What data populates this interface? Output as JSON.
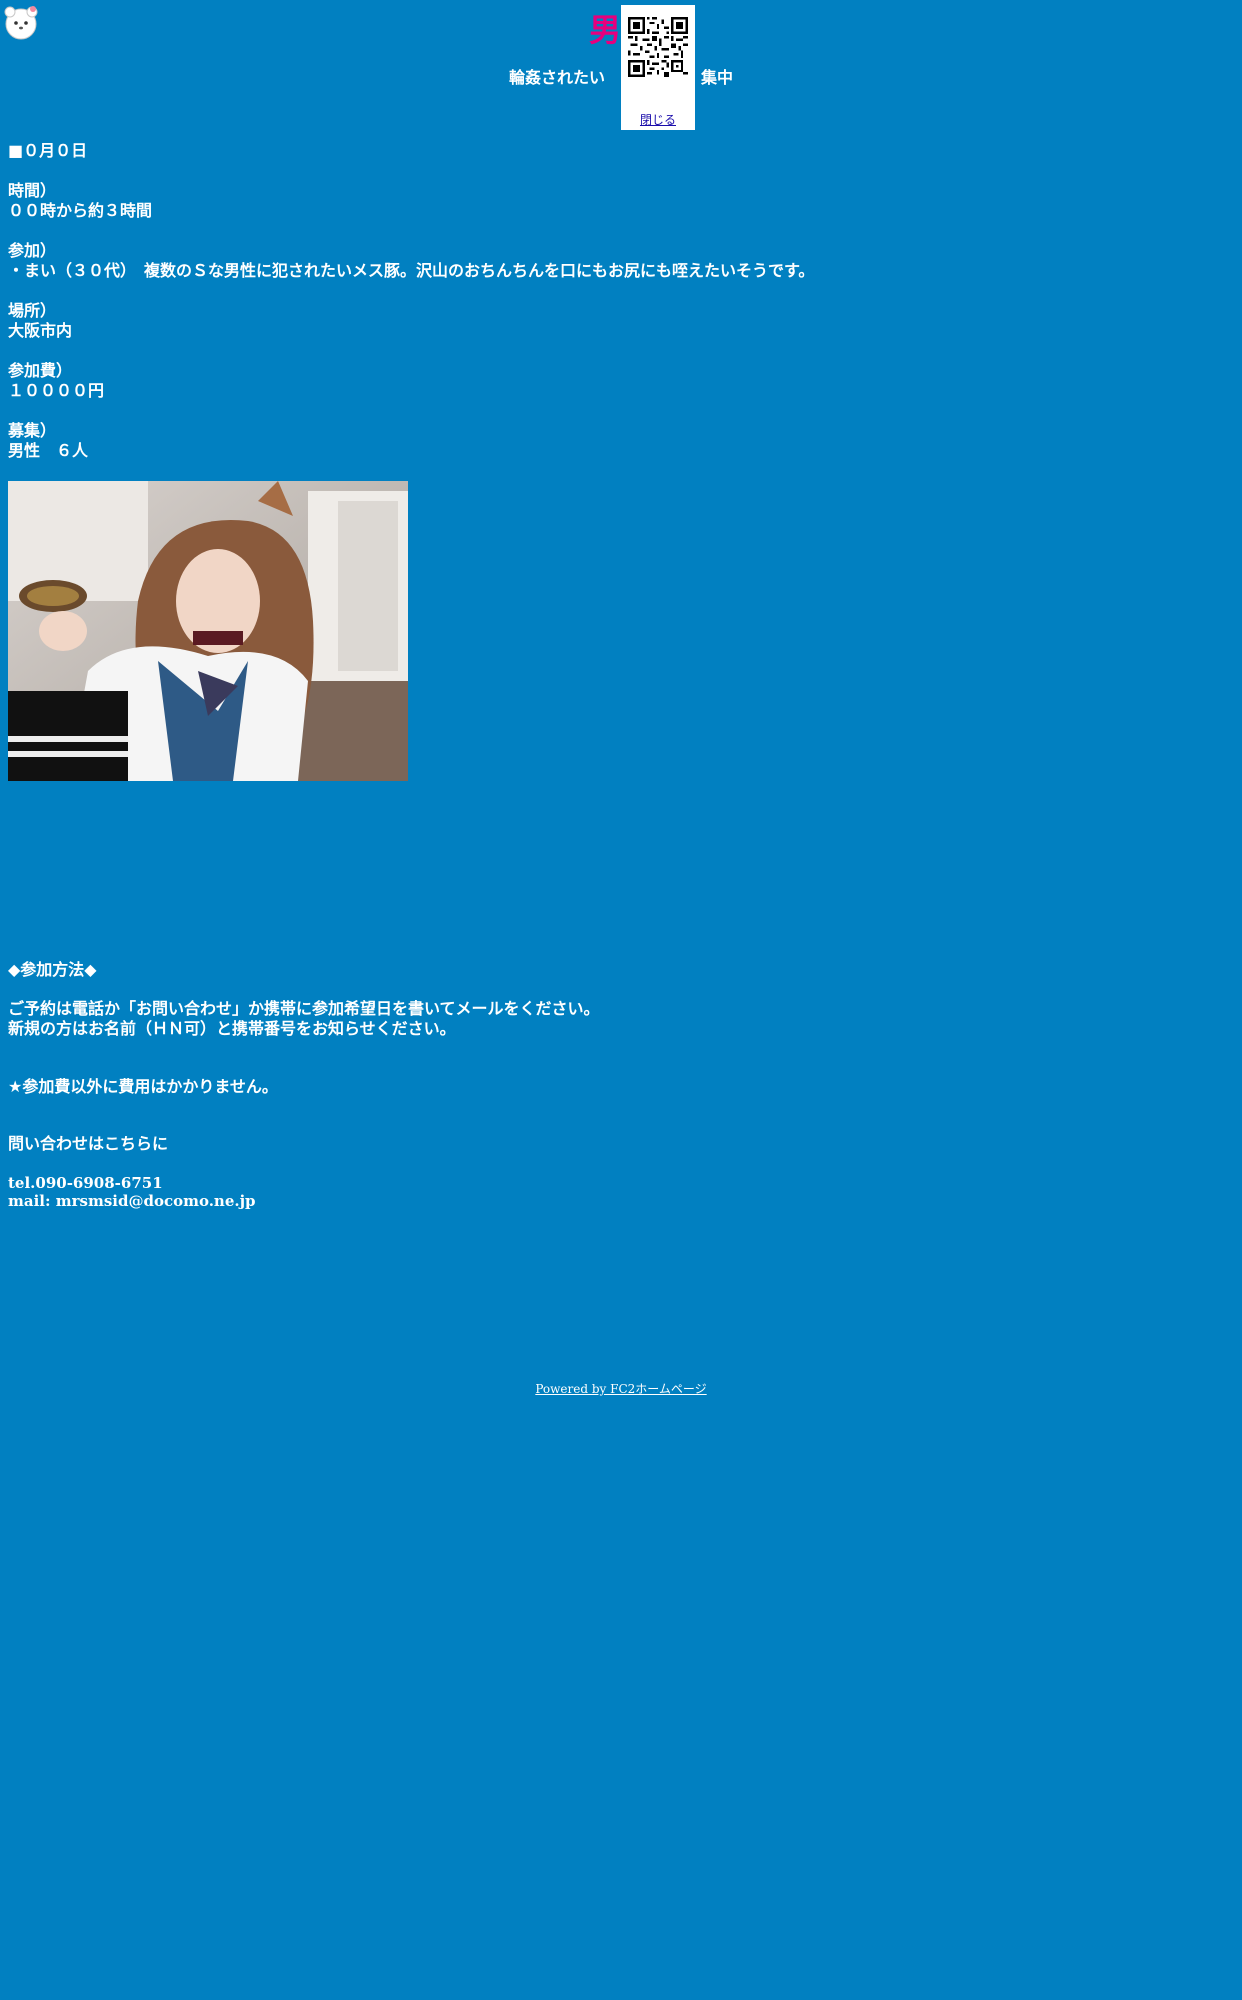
{
  "header": {
    "title": "男の",
    "subtitle": "輪姦されたい",
    "subtitle_suffix": "集中"
  },
  "qr_popup": {
    "close_label": "閉じる"
  },
  "event": {
    "date": "■０月０日",
    "time_label": "時間）",
    "time_value": "００時から約３時間",
    "participant_label": "参加）",
    "participant_value": "・まい（３０代）　複数のＳな男性に犯されたいメス豚。沢山のおちんちんを口にもお尻にも咥えたいそうです。",
    "place_label": "場所）",
    "place_value": "大阪市内",
    "fee_label": "参加費）",
    "fee_value": "１００００円",
    "recruit_label": "募集）",
    "recruit_value": "男性　６人"
  },
  "how_to": {
    "heading": "◆参加方法◆",
    "line1": "ご予約は電話か「お問い合わせ」か携帯に参加希望日を書いてメールをください。",
    "line2": "新規の方はお名前（ＨＮ可）と携帯番号をお知らせください。",
    "note": "★参加費以外に費用はかかりません。"
  },
  "contact": {
    "heading": "問い合わせはこちらに",
    "tel": "tel.090-6908-6751",
    "mail": "mail: mrsmsid@docomo.ne.jp"
  },
  "footer": {
    "powered_by": "Powered by FC2ホームページ"
  },
  "colors": {
    "background": "#0180c1",
    "title": "#e6007e",
    "text": "#ffffff",
    "link": "#1a0dab"
  },
  "icons": {
    "mascot": "white-fluffy-mascot-icon",
    "qr": "qr-code-icon"
  }
}
